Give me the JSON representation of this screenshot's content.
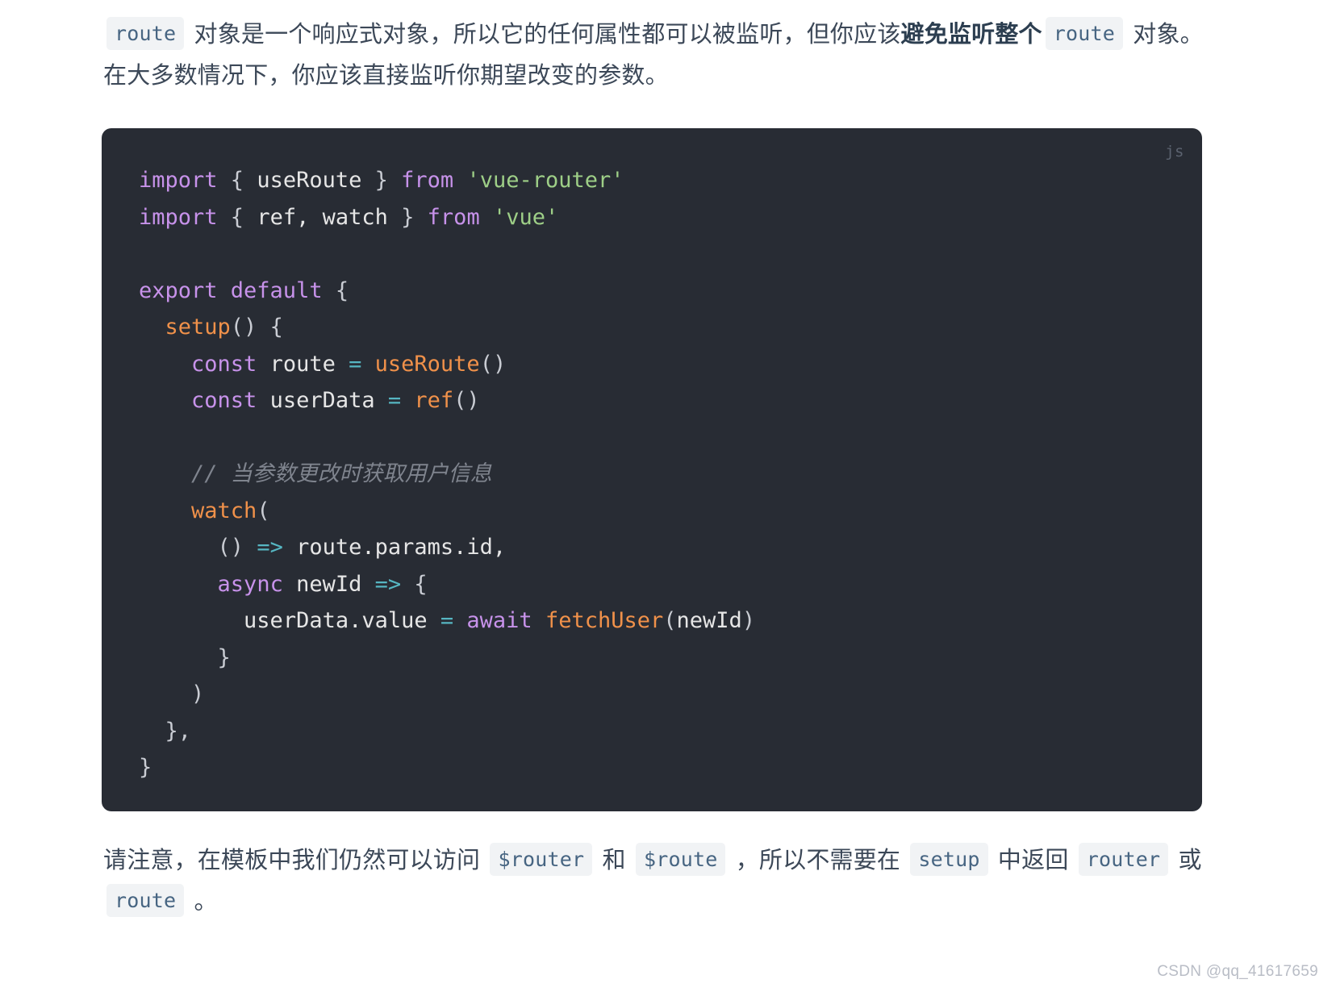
{
  "document": {
    "intro_paragraph": {
      "segments": [
        {
          "type": "code",
          "text": "route"
        },
        {
          "type": "text",
          "text": " 对象是一个响应式对象，所以它的任何属性都可以被监听，但你应该"
        },
        {
          "type": "strong",
          "text": "避免监听整个"
        },
        {
          "type": "code",
          "text": "route"
        },
        {
          "type": "text",
          "text": " 对象。在大多数情况下，你应该直接监听你期望改变的参数。"
        }
      ],
      "code_1": "route",
      "text_1": " 对象是一个响应式对象，所以它的任何属性都可以被监听，但你应该",
      "strong_1": "避免监听整个",
      "code_2": "route",
      "text_2": " 对象。在大多数情况下，你应该直接监听你期望改变的参数。"
    },
    "code_block": {
      "language_label": "js",
      "language": "javascript",
      "background_color": "#282c34",
      "lines": [
        "import { useRoute } from 'vue-router'",
        "import { ref, watch } from 'vue'",
        "",
        "export default {",
        "  setup() {",
        "    const route = useRoute()",
        "    const userData = ref()",
        "",
        "    // 当参数更改时获取用户信息",
        "    watch(",
        "      () => route.params.id,",
        "      async newId => {",
        "        userData.value = await fetchUser(newId)",
        "      }",
        "    )",
        "  },",
        "}"
      ],
      "tokens": {
        "l1_kw_import": "import",
        "l1_brace_open": " { ",
        "l1_ident": "useRoute",
        "l1_brace_close": " } ",
        "l1_kw_from": "from",
        "l1_str": " 'vue-router'",
        "l2_kw_import": "import",
        "l2_brace_open": " { ",
        "l2_ident": "ref, watch",
        "l2_brace_close": " } ",
        "l2_kw_from": "from",
        "l2_str": " 'vue'",
        "l4_kw": "export default",
        "l4_brace": " {",
        "l5_indent": "  ",
        "l5_fn": "setup",
        "l5_rest": "() {",
        "l6_indent": "    ",
        "l6_kw": "const",
        "l6_ident": " route ",
        "l6_op": "=",
        "l6_fn": " useRoute",
        "l6_punc": "()",
        "l7_indent": "    ",
        "l7_kw": "const",
        "l7_ident": " userData ",
        "l7_op": "=",
        "l7_fn": " ref",
        "l7_punc": "()",
        "l9_indent": "    ",
        "l9_com": "// 当参数更改时获取用户信息",
        "l10_indent": "    ",
        "l10_fn": "watch",
        "l10_punc": "(",
        "l11_indent": "      ",
        "l11_punc": "() ",
        "l11_op": "=>",
        "l11_ident": " route.params.id,",
        "l12_indent": "      ",
        "l12_kw": "async",
        "l12_ident": " newId ",
        "l12_op": "=>",
        "l12_punc": " {",
        "l13_indent": "        ",
        "l13_ident": "userData.value ",
        "l13_op": "=",
        "l13_kw": " await",
        "l13_fn": " fetchUser",
        "l13_punc": "(",
        "l13_arg": "newId",
        "l13_punc2": ")",
        "l14_indent": "      ",
        "l14_punc": "}",
        "l15_indent": "    ",
        "l15_punc": ")",
        "l16_indent": "  ",
        "l16_punc": "},",
        "l17_punc": "}"
      }
    },
    "outro_paragraph": {
      "text_1": "请注意，在模板中我们仍然可以访问 ",
      "code_1": "$router",
      "text_2": " 和 ",
      "code_2": "$route",
      "text_3": " ，所以不需要在 ",
      "code_3": "setup",
      "text_4": " 中返回 ",
      "code_4": "router",
      "text_5": " 或 ",
      "code_5": "route",
      "text_6": " 。"
    },
    "watermark": "CSDN @qq_41617659"
  },
  "colors": {
    "page_background": "#ffffff",
    "body_text": "#3c4858",
    "code_chip_background": "#f1f3f5",
    "code_chip_text": "#476582",
    "code_block_background": "#282c34",
    "code_default": "#d9dbe0",
    "keyword": "#c792ea",
    "function": "#f0914a",
    "string": "#9ecf87",
    "operator": "#56b6c2",
    "comment": "#7f848e",
    "watermark": "#b9bdc6"
  }
}
